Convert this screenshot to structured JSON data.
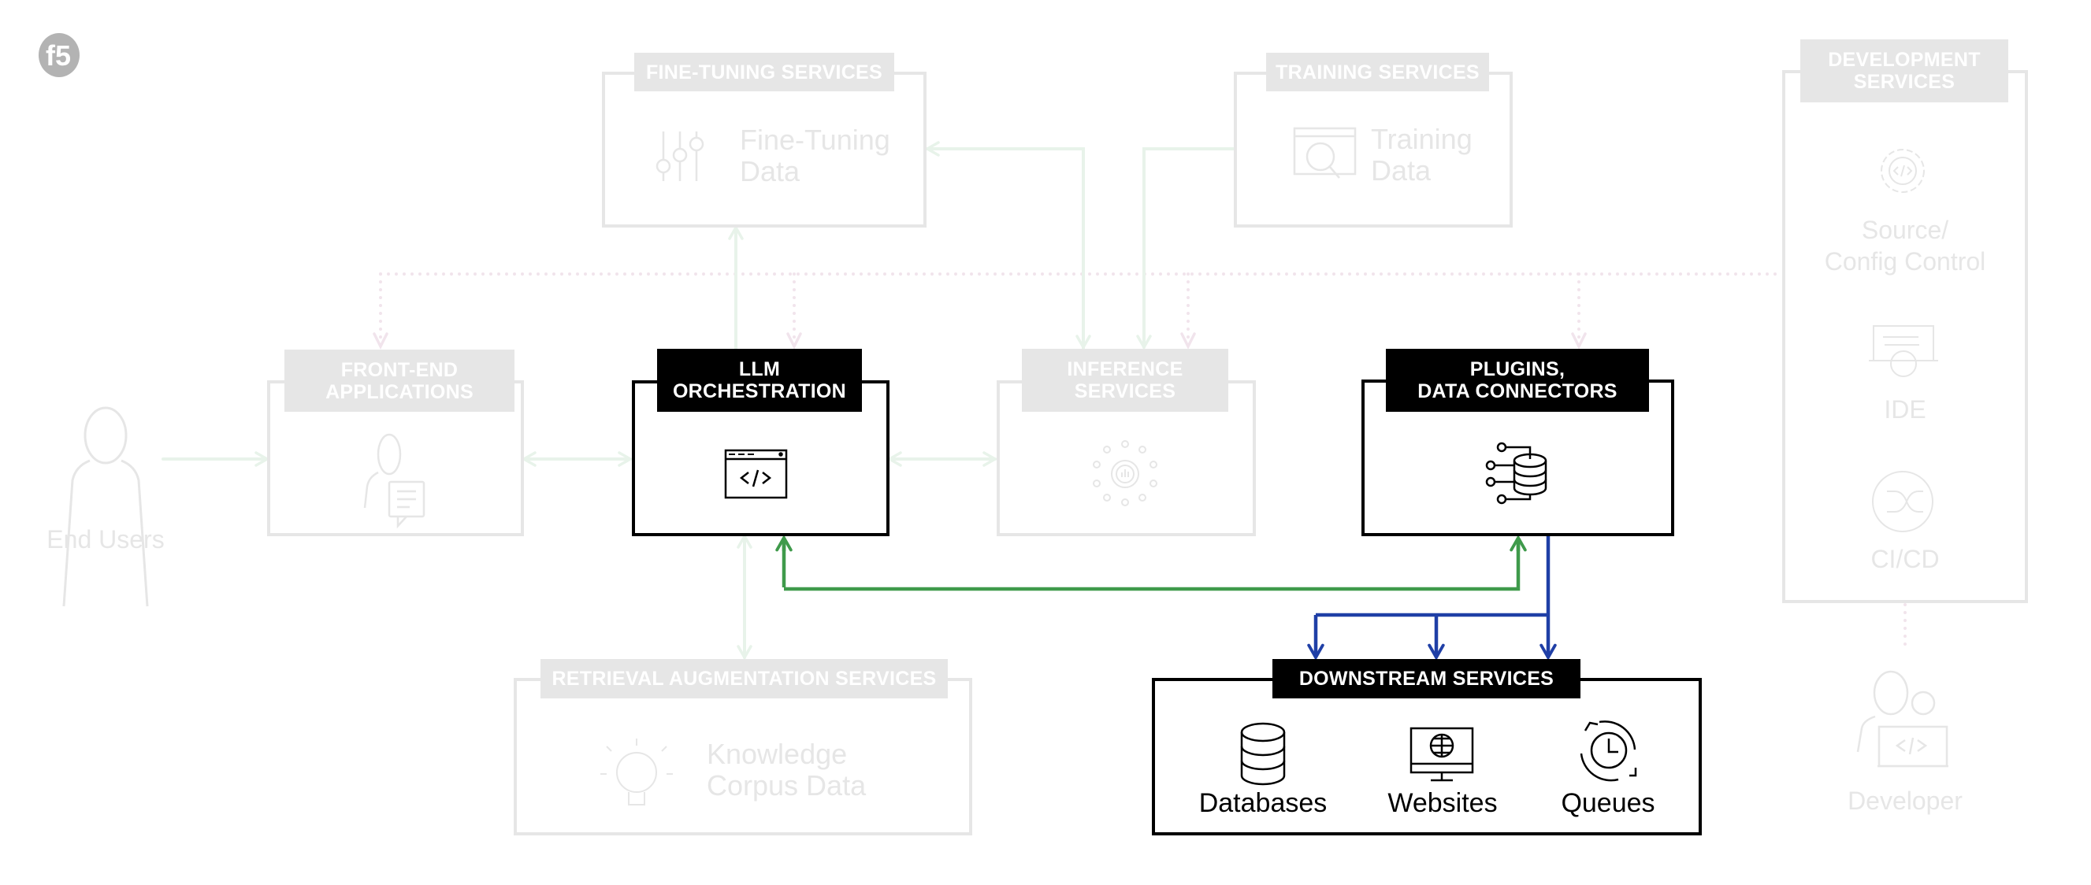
{
  "logo": {
    "text": "f5"
  },
  "nodes": {
    "end_users": {
      "label": "End Users"
    },
    "front_end": {
      "title": "FRONT-END\nAPPLICATIONS"
    },
    "llm_orchestration": {
      "title": "LLM\nORCHESTRATION"
    },
    "inference": {
      "title": "INFERENCE\nSERVICES"
    },
    "plugins": {
      "title": "PLUGINS,\nDATA CONNECTORS"
    },
    "fine_tuning": {
      "title": "FINE-TUNING SERVICES",
      "line1": "Fine-Tuning",
      "line2": "Data"
    },
    "training": {
      "title": "TRAINING SERVICES",
      "line1": "Training",
      "line2": "Data"
    },
    "development": {
      "title": "DEVELOPMENT\nSERVICES",
      "items": [
        {
          "line1": "Source/",
          "line2": "Config Control"
        },
        {
          "line1": "IDE"
        },
        {
          "line1": "CI/CD"
        }
      ]
    },
    "rag": {
      "title": "RETRIEVAL AUGMENTATION SERVICES",
      "line1": "Knowledge",
      "line2": "Corpus Data"
    },
    "downstream": {
      "title": "DOWNSTREAM SERVICES",
      "items": [
        {
          "label": "Databases",
          "icon": "database-icon"
        },
        {
          "label": "Websites",
          "icon": "website-monitor-icon"
        },
        {
          "label": "Queues",
          "icon": "queue-clock-icon"
        }
      ]
    },
    "developer": {
      "label": "Developer"
    }
  },
  "colors": {
    "faded": "#e6e6e6",
    "faded_green": "#e8f3ea",
    "faded_dotted": "#f1e4ec",
    "active": "#000000",
    "green_arrow": "#3f9a4b",
    "blue_arrow": "#1f3fa6"
  }
}
